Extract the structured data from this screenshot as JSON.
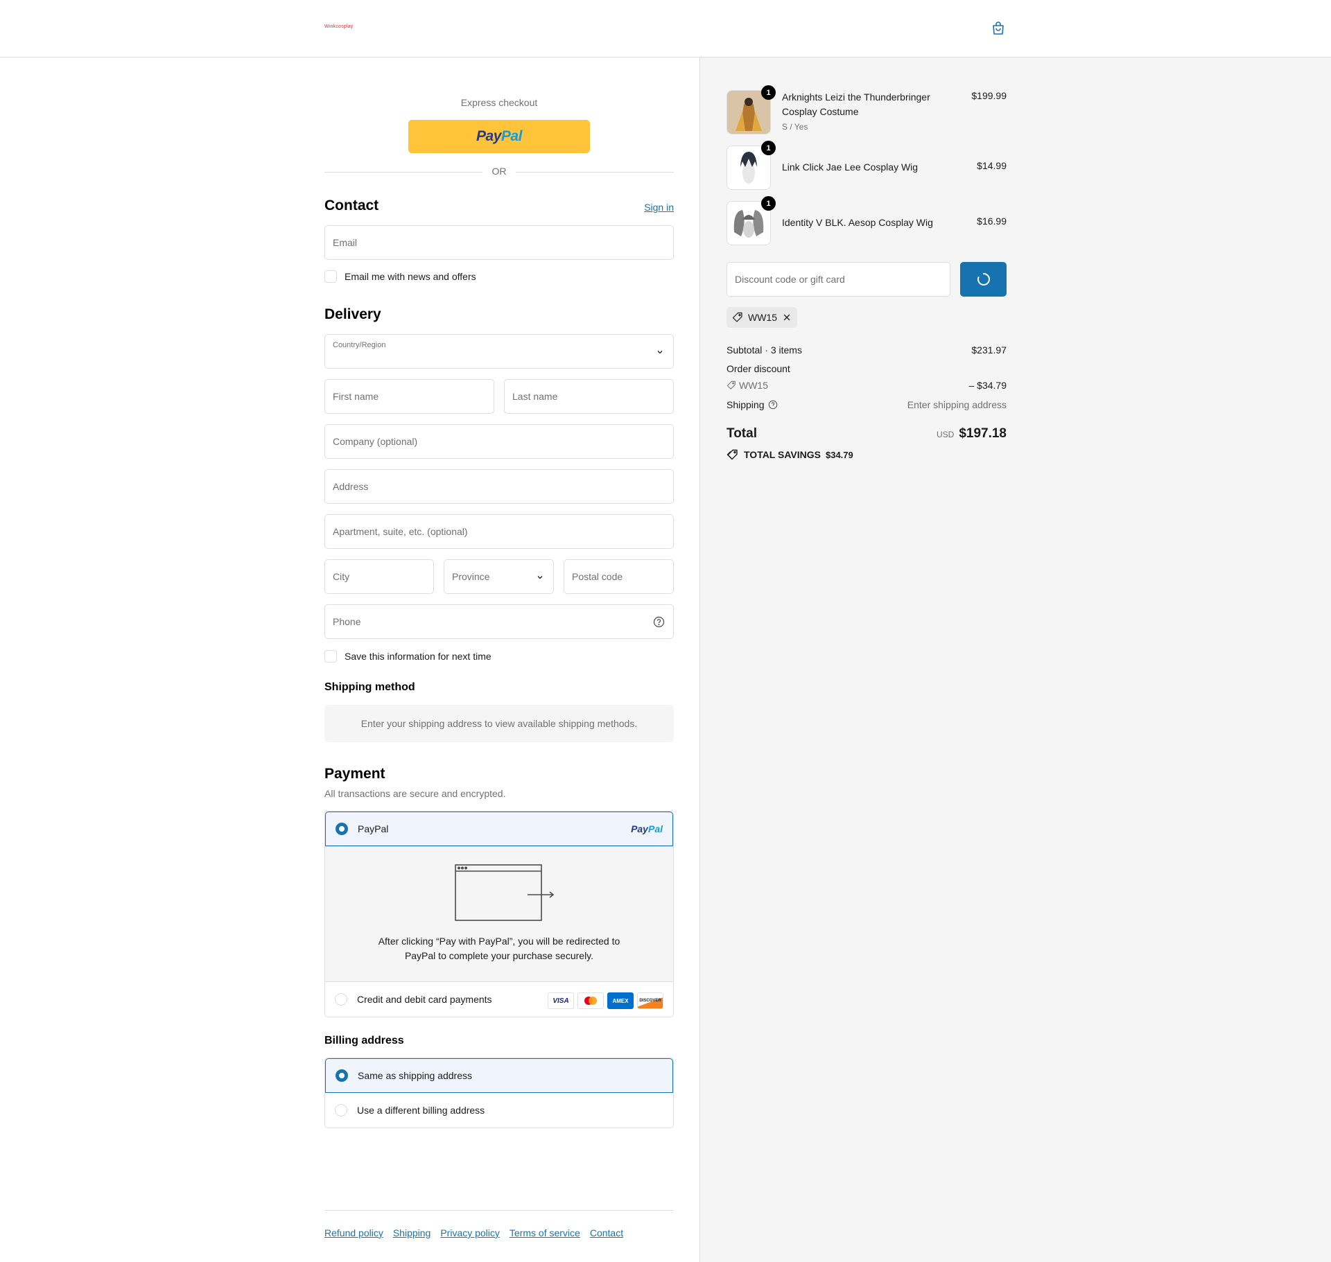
{
  "header": {
    "logo_text": "Winkcosplay",
    "cart_icon": "shopping-bag-icon"
  },
  "express": {
    "title": "Express checkout",
    "paypal_pay": "Pay",
    "paypal_pal": "Pal",
    "or_text": "OR"
  },
  "contact": {
    "title": "Contact",
    "sign_in": "Sign in",
    "email_placeholder": "Email",
    "news_label": "Email me with news and offers"
  },
  "delivery": {
    "title": "Delivery",
    "country_label": "Country/Region",
    "first_name": "First name",
    "last_name": "Last name",
    "company": "Company (optional)",
    "address": "Address",
    "apartment": "Apartment, suite, etc. (optional)",
    "city": "City",
    "province": "Province",
    "postal": "Postal code",
    "phone": "Phone",
    "save_label": "Save this information for next time"
  },
  "shipping_method": {
    "title": "Shipping method",
    "notice": "Enter your shipping address to view available shipping methods."
  },
  "payment": {
    "title": "Payment",
    "subtitle": "All transactions are secure and encrypted.",
    "paypal_label": "PayPal",
    "paypal_logo_pay": "Pay",
    "paypal_logo_pal": "Pal",
    "redirect_line1": "After clicking “Pay with PayPal”, you will be redirected to",
    "redirect_line2": "PayPal to complete your purchase securely.",
    "card_label": "Credit and debit card payments",
    "cards": [
      "VISA",
      "MC",
      "AMEX",
      "DISCOVER"
    ]
  },
  "billing": {
    "title": "Billing address",
    "same": "Same as shipping address",
    "different": "Use a different billing address"
  },
  "footer": {
    "links": [
      "Refund policy",
      "Shipping",
      "Privacy policy",
      "Terms of service",
      "Contact"
    ]
  },
  "cart": {
    "items": [
      {
        "name": "Arknights Leizi the Thunderbringer Cosplay Costume",
        "variant": "S / Yes",
        "price": "$199.99",
        "qty": "1"
      },
      {
        "name": "Link Click Jae Lee Cosplay Wig",
        "variant": "",
        "price": "$14.99",
        "qty": "1"
      },
      {
        "name": "Identity V BLK. Aesop Cosplay Wig",
        "variant": "",
        "price": "$16.99",
        "qty": "1"
      }
    ],
    "discount_placeholder": "Discount code or gift card",
    "applied_code": "WW15",
    "subtotal_label": "Subtotal · 3 items",
    "subtotal_value": "$231.97",
    "order_discount_label": "Order discount",
    "discount_code": "WW15",
    "discount_value": "– $34.79",
    "shipping_label": "Shipping",
    "shipping_value": "Enter shipping address",
    "total_label": "Total",
    "currency": "USD",
    "total_value": "$197.18",
    "savings_label": "TOTAL SAVINGS",
    "savings_value": "$34.79"
  },
  "colors": {
    "accent": "#1773b0",
    "paypal_yellow": "#ffc439",
    "panel_bg": "#f5f5f5",
    "border": "#dedede"
  }
}
